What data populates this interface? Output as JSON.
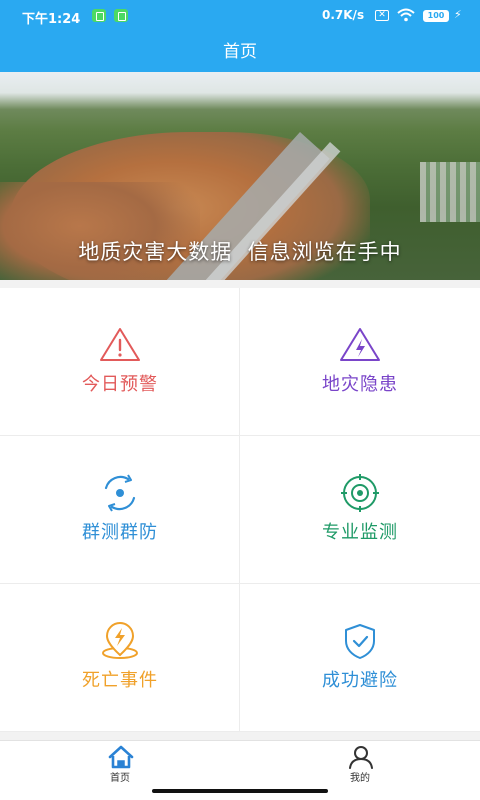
{
  "status_bar": {
    "time": "下午1:24",
    "network_speed": "0.7K/s",
    "battery": "100",
    "icons": [
      "notification-icon",
      "notification-icon",
      "sim-icon",
      "wifi-icon",
      "battery-icon",
      "charging-icon"
    ]
  },
  "header": {
    "title": "首页"
  },
  "banner": {
    "caption": "地质灾害大数据  信息浏览在手中"
  },
  "grid": {
    "items": [
      {
        "label": "今日预警",
        "icon": "warning-triangle-icon",
        "color": "#e25a5a"
      },
      {
        "label": "地灾隐患",
        "icon": "hazard-triangle-icon",
        "color": "#7a45c9"
      },
      {
        "label": "群测群防",
        "icon": "monitor-cycle-icon",
        "color": "#2f8fd6"
      },
      {
        "label": "专业监测",
        "icon": "target-icon",
        "color": "#1f9a67"
      },
      {
        "label": "死亡事件",
        "icon": "lightning-pin-icon",
        "color": "#f0a12a"
      },
      {
        "label": "成功避险",
        "icon": "shield-check-icon",
        "color": "#2f8fd6"
      }
    ]
  },
  "bottom_nav": {
    "items": [
      {
        "label": "首页",
        "icon": "home-icon",
        "color": "#2a82d4"
      },
      {
        "label": "我的",
        "icon": "user-icon",
        "color": "#333333"
      }
    ]
  },
  "colors": {
    "primary": "#2aa9f1",
    "background": "#f2f2f2"
  }
}
